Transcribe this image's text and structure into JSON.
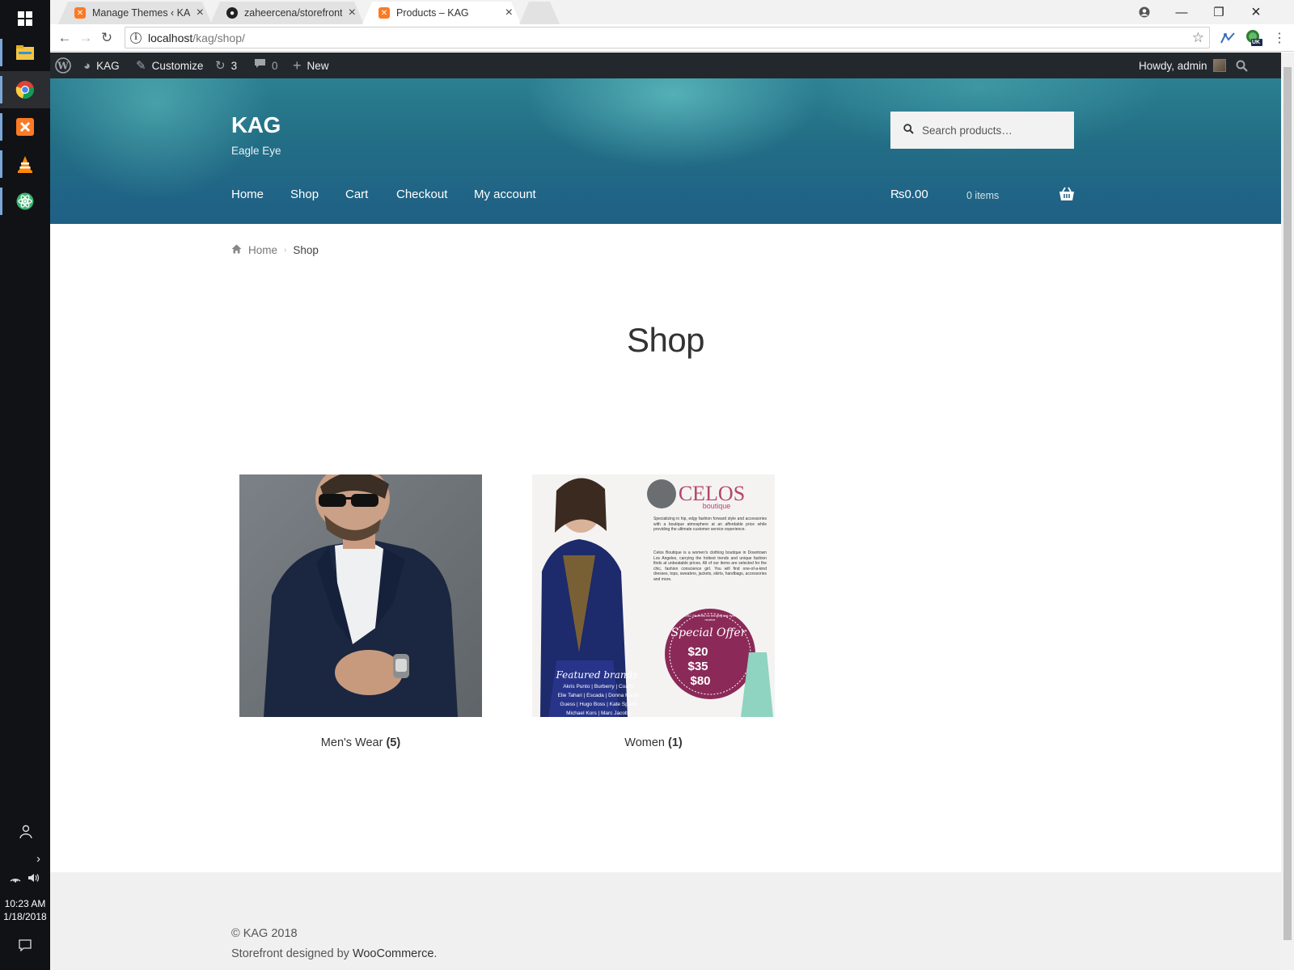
{
  "taskbar": {
    "apps": [
      {
        "name": "file-explorer"
      },
      {
        "name": "chrome"
      },
      {
        "name": "xampp"
      },
      {
        "name": "vlc"
      },
      {
        "name": "atom"
      }
    ],
    "time": "10:23 AM",
    "date": "1/18/2018"
  },
  "browser": {
    "tabs": [
      {
        "title": "Manage Themes ‹ KAG —",
        "favicon": "xampp-icon"
      },
      {
        "title": "zaheercena/storefront: C",
        "favicon": "github-icon"
      },
      {
        "title": "Products – KAG",
        "favicon": "xampp-icon",
        "active": true
      }
    ],
    "url_host": "localhost",
    "url_path": "/kag/shop/",
    "extension_badge": "UK"
  },
  "admin_bar": {
    "site_name": "KAG",
    "customize": "Customize",
    "updates": "3",
    "comments": "0",
    "new": "New",
    "greeting": "Howdy, admin"
  },
  "header": {
    "site_title": "KAG",
    "tagline": "Eagle Eye",
    "search_placeholder": "Search products…",
    "nav": [
      "Home",
      "Shop",
      "Cart",
      "Checkout",
      "My account"
    ],
    "cart_amount": "₨0.00",
    "cart_items": "0 items"
  },
  "breadcrumb": {
    "home": "Home",
    "current": "Shop"
  },
  "page": {
    "title": "Shop"
  },
  "categories": [
    {
      "name": "Men's Wear",
      "count": "(5)"
    },
    {
      "name": "Women",
      "count": "(1)"
    }
  ],
  "flyer": {
    "brand": "CELOS",
    "sub": "boutique",
    "blurb1": "Specializing in hip, edgy fashion forward style and accessories with a boutique atmosphere at an affordable price while providing the ultimate customer service experience.",
    "blurb2": "Celos Boutique is a women's clothing boutique in Downtown Los Angeles, carrying the hottest trends and unique fashion finds at unbeatable prices. All of our items are selected for the chic, fashion conscience girl. You will find one-of-a-kind dresses, tops, sweaters, jackets, skirts, handbags, accessories and more.",
    "offer_head": "USC Students for bringing this flyer receive",
    "offer_title": "Special Offer",
    "offers": [
      "$20",
      "$35",
      "$80"
    ],
    "featured": "Featured brands",
    "brands1": "Akris Punto | Burberry | Coach",
    "brands2": "Elie Tahari | Escada | Donna Karan",
    "brands3": "Guess | Hugo Boss | Kate Spade",
    "brands4": "Michael Kors | Marc Jacobs"
  },
  "footer": {
    "copyright": "© KAG 2018",
    "credit_prefix": "Storefront designed by ",
    "credit_link": "WooCommerce",
    "credit_suffix": "."
  },
  "colors": {
    "admin_bar": "#23282d",
    "header_start": "#2c7f91",
    "header_end": "#1f5f85",
    "footer_bg": "#f0f0f0"
  }
}
